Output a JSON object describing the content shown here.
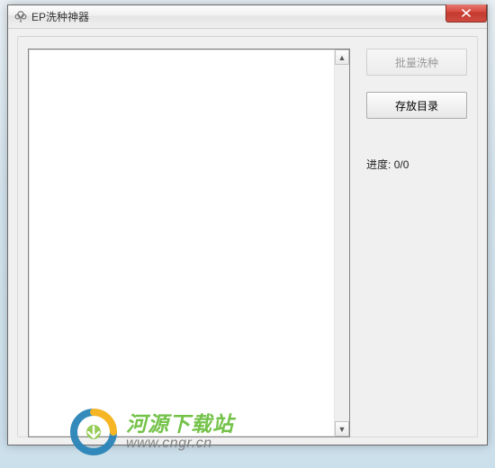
{
  "window": {
    "title": "EP洗种神器"
  },
  "buttons": {
    "batch_wash": "批量洗种",
    "save_dir": "存放目录"
  },
  "progress": {
    "label": "进度:",
    "value": "0/0"
  },
  "watermark": {
    "site_name": "河源下载站",
    "site_url": "www.cngr.cn"
  },
  "icons": {
    "app": "tree-icon",
    "close": "close-icon",
    "scroll_up": "chevron-up-icon",
    "scroll_down": "chevron-down-icon"
  }
}
